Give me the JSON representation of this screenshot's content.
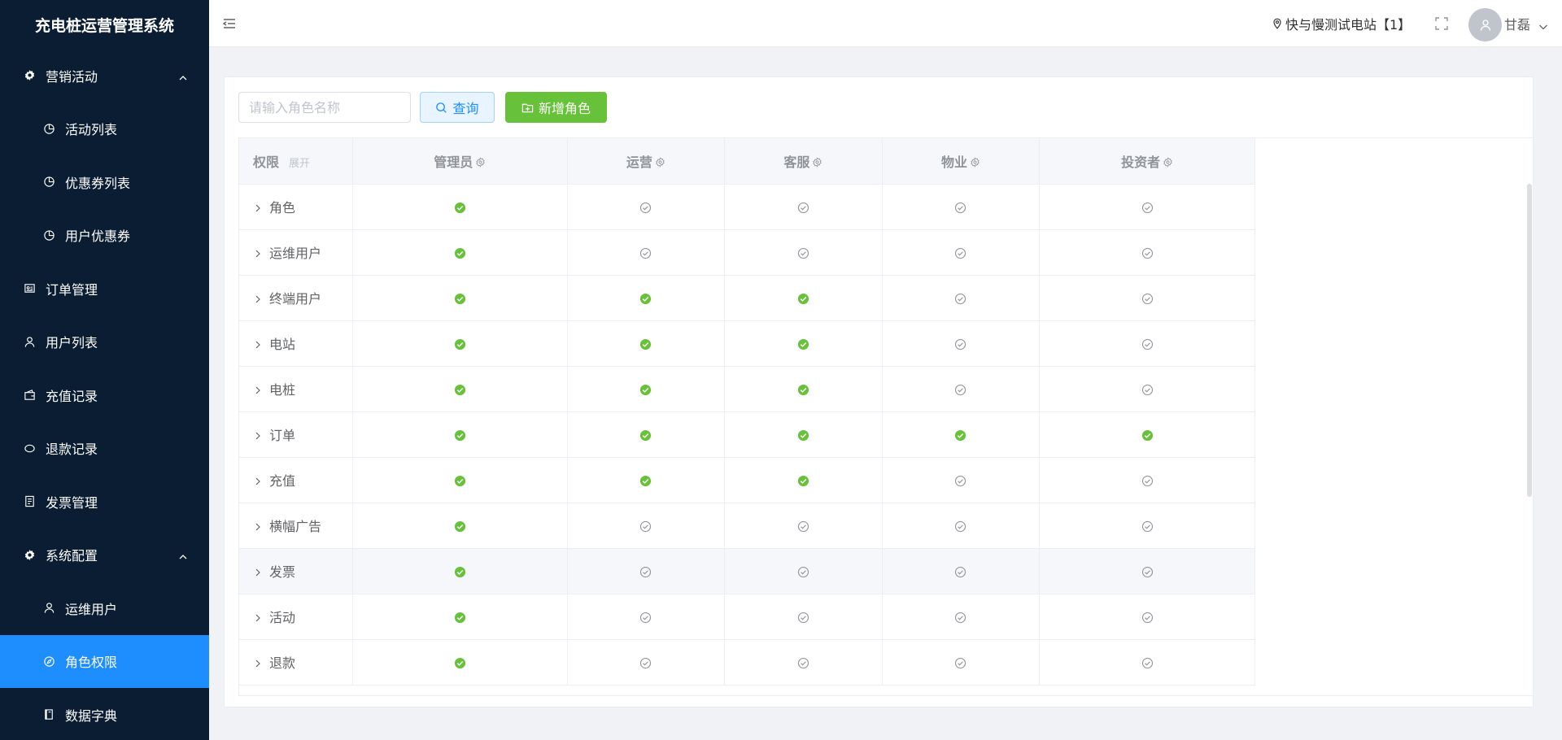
{
  "app": {
    "title": "充电桩运营管理系统"
  },
  "sidebar": {
    "items": [
      {
        "label": "营销活动",
        "icon": "gear-icon",
        "level": 1,
        "expanded": true
      },
      {
        "label": "活动列表",
        "icon": "pie-icon",
        "level": 2
      },
      {
        "label": "优惠券列表",
        "icon": "pie-icon",
        "level": 2
      },
      {
        "label": "用户优惠券",
        "icon": "pie-icon",
        "level": 2
      },
      {
        "label": "订单管理",
        "icon": "order-icon",
        "level": 1
      },
      {
        "label": "用户列表",
        "icon": "user-icon",
        "level": 1
      },
      {
        "label": "充值记录",
        "icon": "wallet-icon",
        "level": 1
      },
      {
        "label": "退款记录",
        "icon": "refund-icon",
        "level": 1
      },
      {
        "label": "发票管理",
        "icon": "invoice-icon",
        "level": 1
      },
      {
        "label": "系统配置",
        "icon": "gear-icon",
        "level": 1,
        "expanded": true
      },
      {
        "label": "运维用户",
        "icon": "user-icon",
        "level": 2
      },
      {
        "label": "角色权限",
        "icon": "compass-icon",
        "level": 2,
        "active": true
      },
      {
        "label": "数据字典",
        "icon": "book-icon",
        "level": 2
      }
    ]
  },
  "header": {
    "station": "快与慢测试电站【1】",
    "user_name": "甘磊"
  },
  "toolbar": {
    "search_placeholder": "请输入角色名称",
    "query_label": "查询",
    "add_label": "新增角色"
  },
  "table": {
    "perm_header": "权限",
    "expand_label": "展开",
    "roles": [
      "管理员",
      "运营",
      "客服",
      "物业",
      "投资者"
    ],
    "rows": [
      {
        "name": "角色",
        "checks": [
          true,
          false,
          false,
          false,
          false
        ]
      },
      {
        "name": "运维用户",
        "checks": [
          true,
          false,
          false,
          false,
          false
        ]
      },
      {
        "name": "终端用户",
        "checks": [
          true,
          true,
          true,
          false,
          false
        ]
      },
      {
        "name": "电站",
        "checks": [
          true,
          true,
          true,
          false,
          false
        ]
      },
      {
        "name": "电桩",
        "checks": [
          true,
          true,
          true,
          false,
          false
        ]
      },
      {
        "name": "订单",
        "checks": [
          true,
          true,
          true,
          true,
          true
        ]
      },
      {
        "name": "充值",
        "checks": [
          true,
          true,
          true,
          false,
          false
        ]
      },
      {
        "name": "横幅广告",
        "checks": [
          true,
          false,
          false,
          false,
          false
        ]
      },
      {
        "name": "发票",
        "checks": [
          true,
          false,
          false,
          false,
          false
        ],
        "highlighted": true
      },
      {
        "name": "活动",
        "checks": [
          true,
          false,
          false,
          false,
          false
        ]
      },
      {
        "name": "退款",
        "checks": [
          true,
          false,
          false,
          false,
          false
        ]
      }
    ]
  },
  "colors": {
    "sidebar_bg": "#0b1d33",
    "active": "#1e8eff",
    "checked": "#67c23a",
    "unchecked": "#909399"
  }
}
